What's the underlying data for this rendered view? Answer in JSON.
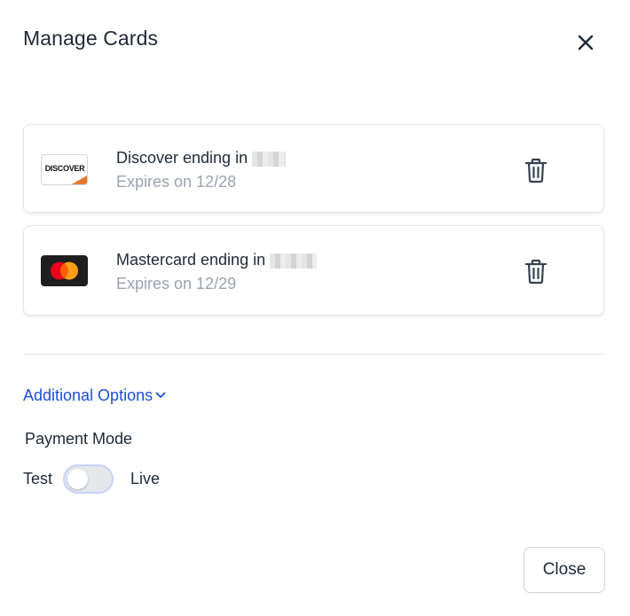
{
  "modal": {
    "title": "Manage Cards",
    "close_icon": "close-icon"
  },
  "cards": [
    {
      "brand": "Discover",
      "logo_text": "DISCOVER",
      "logo_accent": "#e8772e",
      "name": "Discover ending in",
      "expires": "Expires on 12/28",
      "delete_icon": "trash-icon"
    },
    {
      "brand": "Mastercard",
      "name": "Mastercard ending in",
      "expires": "Expires on 12/29",
      "logo_colors": [
        "#eb001b",
        "#f79e1b"
      ],
      "delete_icon": "trash-icon"
    }
  ],
  "additional_options": {
    "label": "Additional Options",
    "icon": "chevron-down-icon"
  },
  "payment_mode": {
    "label": "Payment Mode",
    "left_label": "Test",
    "right_label": "Live",
    "state": "Test"
  },
  "footer": {
    "close_label": "Close"
  },
  "colors": {
    "link": "#1d4ed8",
    "muted_text": "#9ca3af",
    "border": "#e5e7eb",
    "toggle_ring": "#c7d2fe"
  }
}
